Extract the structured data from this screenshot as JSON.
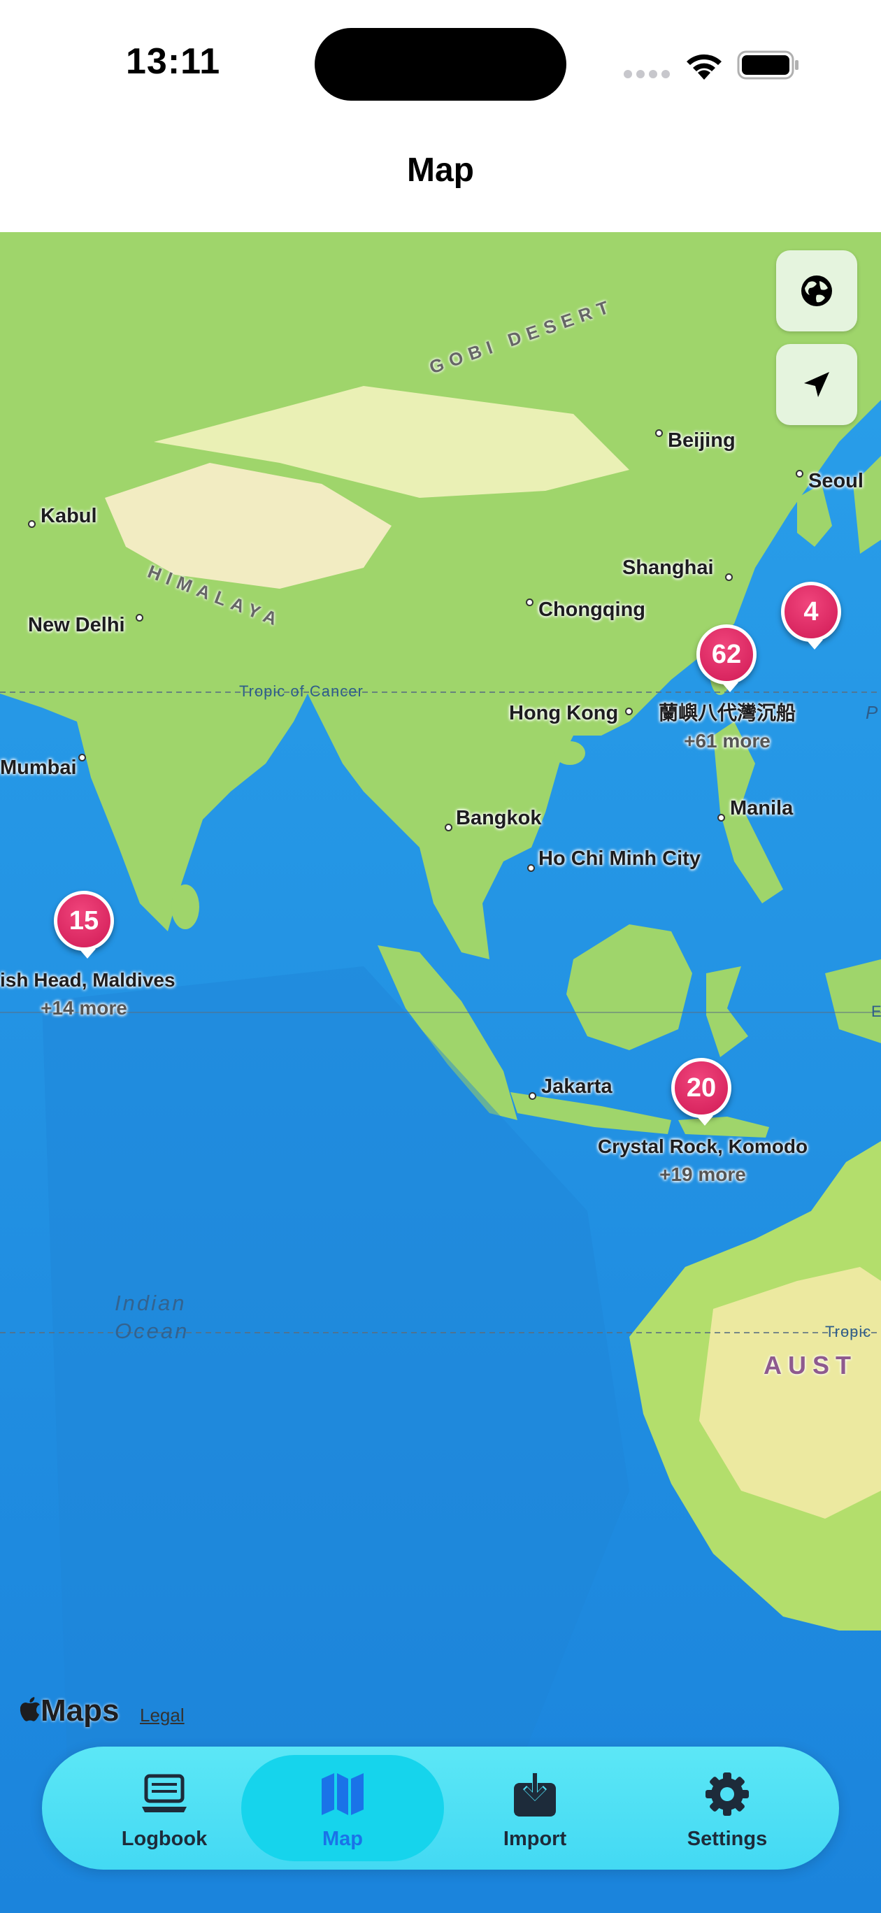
{
  "status_bar": {
    "time": "13:11"
  },
  "nav": {
    "title": "Map"
  },
  "map": {
    "places": [
      "Beijing",
      "Seoul",
      "Kabul",
      "Shanghai",
      "Chongqing",
      "New Delhi",
      "Hong Kong",
      "Mumbai",
      "Manila",
      "Bangkok",
      "Ho Chi Minh City",
      "Jakarta"
    ],
    "regions": [
      "GOBI DESERT",
      "HIMALAYA",
      "AUST"
    ],
    "tropics": [
      "Tropic of Cancer",
      "Tropic"
    ],
    "edge_letters": [
      "P",
      "E"
    ],
    "ocean": [
      "Indian",
      "Ocean"
    ],
    "clusters": [
      {
        "count": "4",
        "title": "",
        "more": ""
      },
      {
        "count": "62",
        "title": "蘭嶼八代灣沉船",
        "more": "+61 more"
      },
      {
        "count": "15",
        "title": "ish Head, Maldives",
        "more": "+14 more"
      },
      {
        "count": "20",
        "title": "Crystal Rock, Komodo",
        "more": "+19 more"
      }
    ],
    "buttons": [
      "globe-icon",
      "location-arrow-icon"
    ],
    "attribution": {
      "logo": "Maps",
      "legal": "Legal"
    },
    "colors": {
      "ocean": "#1f8ee0",
      "land": "#9ed66a",
      "pin": "#e0245e"
    }
  },
  "tabs": [
    {
      "label": "Logbook",
      "icon": "laptop-icon",
      "selected": false
    },
    {
      "label": "Map",
      "icon": "map-icon",
      "selected": true
    },
    {
      "label": "Import",
      "icon": "import-icon",
      "selected": false
    },
    {
      "label": "Settings",
      "icon": "gear-icon",
      "selected": false
    }
  ]
}
